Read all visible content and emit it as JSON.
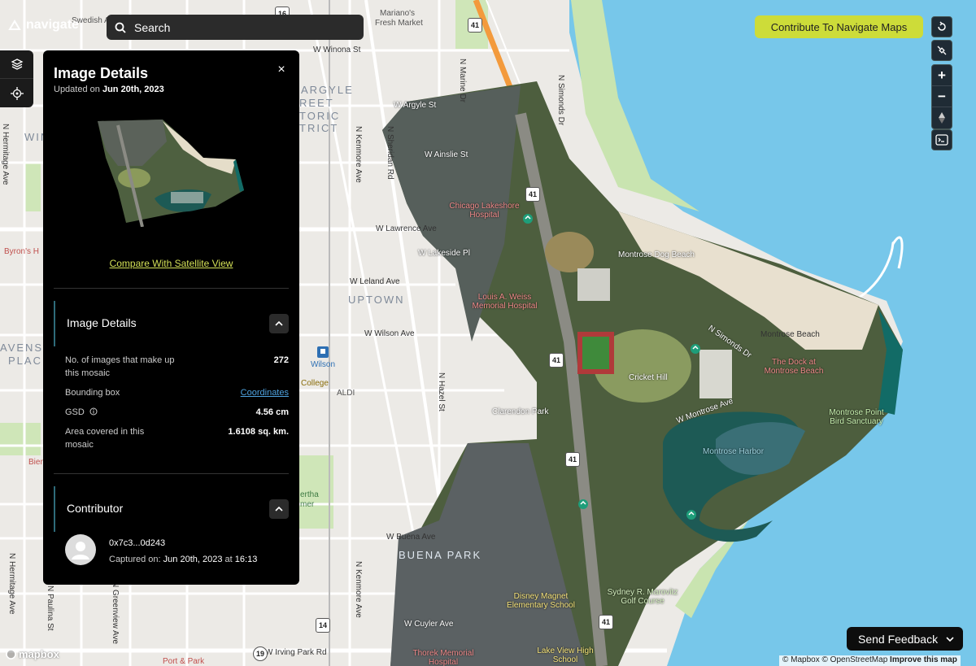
{
  "brand": {
    "name": "navigate"
  },
  "search": {
    "placeholder": "Search"
  },
  "top_right": {
    "contribute_label": "Contribute To Navigate Maps"
  },
  "zoom": {
    "in": "+",
    "out": "−"
  },
  "panel": {
    "title": "Image Details",
    "updated_prefix": "Updated on",
    "updated_date": "Jun 20th, 2023",
    "close": "×",
    "compare_link": "Compare With Satellite View",
    "details_section": {
      "title": "Image Details",
      "rows": [
        {
          "key": "No. of images that make up this mosaic",
          "value": "272"
        },
        {
          "key": "Bounding box",
          "value": "Coordinates"
        },
        {
          "key": "GSD",
          "value": "4.56 cm"
        },
        {
          "key": "Area covered in this mosaic",
          "value": "1.6108 sq. km."
        }
      ]
    },
    "contributor_section": {
      "title": "Contributor",
      "id": "0x7c3...0d243",
      "captured_label": "Captured on:",
      "captured_date": "Jun 20th, 2023",
      "captured_at": "at",
      "captured_time": "16:13"
    }
  },
  "feedback": {
    "label": "Send Feedback"
  },
  "attribution": {
    "mapbox": "© Mapbox",
    "osm": "© OpenStreetMap",
    "improve": "Improve this map"
  },
  "mapbox_logo": "mapbox",
  "map_labels": {
    "swedish": "Swedish A",
    "marianos": "Mariano's",
    "fresh_market": "Fresh Market",
    "winona": "W Winona St",
    "argyle1": "ARGYLE",
    "argyle2": "REET",
    "argyle3": "TORIC",
    "argyle4": "TRICT",
    "argyle_st": "W Argyle St",
    "ainslie": "W Ainslie St",
    "hospital": "Chicago Lakeshore Hospital",
    "lawrence": "W Lawrence Ave",
    "lakeside": "W Lakeside Pl",
    "dog_beach": "Montrose Dog Beach",
    "leland": "W Leland Ave",
    "uptown": "UPTOWN",
    "weiss": "Louis A. Weiss Memorial Hospital",
    "wilson": "W Wilson Ave",
    "wilson_station": "Wilson",
    "college": "College",
    "aldi": "ALDI",
    "montrose_beach": "Montrose Beach",
    "montrose_dr": "N Simonds Dr",
    "dock": "The Dock at Montrose Beach",
    "cricket": "Cricket Hill",
    "montrose_ave": "W Montrose Ave",
    "clarendon": "Clarendon Park",
    "point_bird": "Montrose Point Bird Sanctuary",
    "harbor": "Montrose Harbor",
    "byron": "Byron's H",
    "ravenswood1": "AVENSWO",
    "ravenswood2": "PLACE",
    "winn": "WIN",
    "bertha": "ertha",
    "bertha2": "mer",
    "buena": "W Buena Ave",
    "buena_park": "BUENA PARK",
    "bien": "Bien",
    "disney": "Disney Magnet Elementary School",
    "marovitz": "Sydney R. Marovitz Golf Course",
    "sheridan": "N Sheridan Rd",
    "marine": "N Marine Dr",
    "simonds": "N Simonds Dr",
    "kenmore": "N Kenmore Ave",
    "kenmore2": "N Kenmore Ave",
    "hazel": "N Hazel St",
    "hermitage": "N Hermitage Ave",
    "hermitage2": "N Hermitage Ave",
    "paulina": "N Paulina St",
    "greenview": "N Greenview Ave",
    "irving": "W Irving Park Rd",
    "thorek": "Thorek Memorial Hospital",
    "port": "Port & Park",
    "cuyler": "W Cuyler Ave",
    "lakeview": "Lake View High School",
    "shield_41a": "41",
    "shield_41b": "41",
    "shield_41c": "41",
    "shield_41d": "41",
    "shield_41e": "41",
    "shield_14": "14",
    "shield_19": "19",
    "shield_16": "16"
  }
}
